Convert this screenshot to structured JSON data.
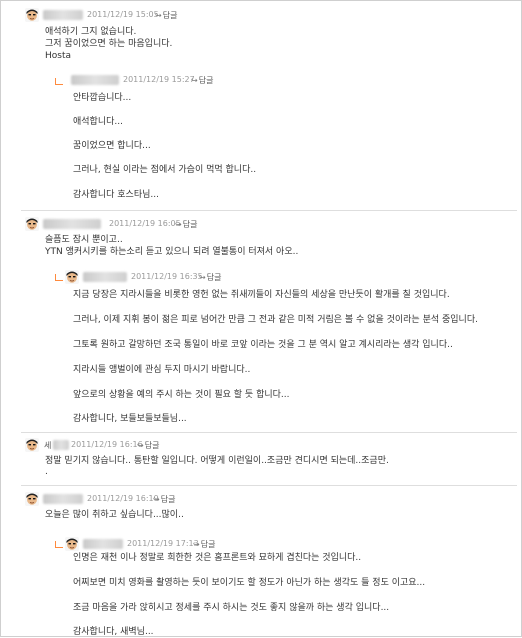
{
  "reply_label": "답글",
  "colors": {
    "reply_marker": "#ff8a3d",
    "date": "#9a9a9a",
    "separator": "#dedede"
  },
  "comments": [
    {
      "author": "",
      "date": "2011/12/19 15:05",
      "lines": [
        "애석하기 그지 없습니다.",
        "그저 꿈이었으면 하는 마음입니다.",
        "Hosta"
      ]
    },
    {
      "author": "",
      "date": "2011/12/19 15:27",
      "lines": [
        "안타깝습니다...",
        "애석합니다...",
        "꿈이었으면 합니다...",
        "그러나, 현실 이라는 점에서 가슴이 먹먹 합니다..",
        "감사합니다 호스타님..."
      ]
    },
    {
      "author": "",
      "date": "2011/12/19 16:05",
      "lines": [
        "슬픔도 잠시 뿐이고..",
        "YTN 앵커시키를 하는소리 듣고 있으니 되려 열불통이 터져서 아오.."
      ]
    },
    {
      "author": "",
      "date": "2011/12/19 16:35",
      "lines": [
        "지금 당장은 지라시들을 비롯한 영헌 없는 쥐새끼들이 자신들의 세상을 만난듯이 활개를 칠 것입니다.",
        "그러나, 이제 지휘 봉이 젊은 피로 넘어간 만큼 그 전과 같은 미적 거림은 볼 수 없을 것이라는 분석 중입니다.",
        "그토록 원하고 갈망하던 조국 통일이 바로 코앞 이라는 것을 그 분 역시 알고 계시리라는 생각 입니다..",
        "지라시들 앵벌이에 관심 두지 마시기 바랍니다..",
        "앞으로의 상황을 예의 주시 하는 것이 필요 할 듯 합니다...",
        "감사합니다, 보들보들보들님..."
      ]
    },
    {
      "author": "세",
      "date": "2011/12/19 16:16",
      "lines": [
        "정말 믿기지 않습니다.. 통탄할 일입니다. 어떻게 이런일이..조금만 견디시면 되는데..조금만.",
        "."
      ]
    },
    {
      "author": "",
      "date": "2011/12/19 16:19",
      "lines": [
        "오늘은 많이 취하고 싶습니다...많이.."
      ]
    },
    {
      "author": "",
      "date": "2011/12/19 17:13",
      "lines": [
        "인명은 재천 이나 정말로 희한한 것은 홈프론트와 묘하게 겹친다는 것입니다..",
        "어찌보면 미치 영화를 촬영하는 듯이 보이기도 할 정도가 아닌가 하는 생각도 들 정도 이고요...",
        "조금 마음을 가라 앉히시고 정세를 주시 하시는 것도 좋지 않을까 하는 생각 입니다...",
        "감사합니다, 새벽님..."
      ]
    }
  ]
}
